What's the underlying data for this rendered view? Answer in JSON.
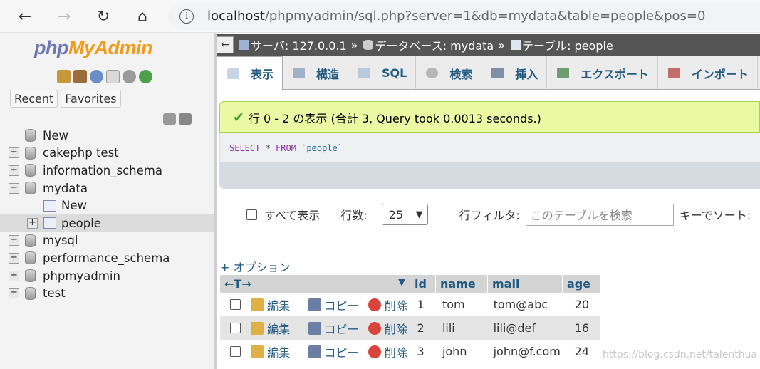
{
  "browser": {
    "url_host": "localhost",
    "url_path": "/phpmyadmin/sql.php?server=1&db=mydata&table=people&pos=0"
  },
  "sidebar": {
    "logo_php": "php",
    "logo_myadmin": "MyAdmin",
    "recent": "Recent",
    "favorites": "Favorites",
    "tree": [
      {
        "label": "New"
      },
      {
        "label": "cakephp test"
      },
      {
        "label": "information_schema"
      },
      {
        "label": "mydata"
      },
      {
        "label": "New"
      },
      {
        "label": "people"
      },
      {
        "label": "mysql"
      },
      {
        "label": "performance_schema"
      },
      {
        "label": "phpmyadmin"
      },
      {
        "label": "test"
      }
    ]
  },
  "breadcrumb": {
    "server": "サーバ: 127.0.0.1",
    "database": "データベース: mydata",
    "table": "テーブル: people",
    "sep": "»"
  },
  "menu": {
    "browse": "表示",
    "structure": "構造",
    "sql": "SQL",
    "search": "検索",
    "insert": "挿入",
    "export": "エクスポート",
    "import": "インポート"
  },
  "message": "行 0 - 2 の表示 (合計 3, Query took 0.0013 seconds.)",
  "query": {
    "select": "SELECT",
    "star": " * ",
    "from": "FROM",
    "table": " `people`"
  },
  "controls": {
    "show_all": "すべて表示",
    "rows_label": "行数:",
    "rows_value": "25",
    "filter_label": "行フィルタ:",
    "filter_placeholder": "このテーブルを検索",
    "sort_label": "キーでソート:"
  },
  "options_link": "+ オプション",
  "grid": {
    "arrows_left": "←T→",
    "columns": [
      "id",
      "name",
      "mail",
      "age"
    ],
    "edit": "編集",
    "copy": "コピー",
    "delete": "削除",
    "rows": [
      {
        "id": "1",
        "name": "tom",
        "mail": "tom@abc",
        "age": "20"
      },
      {
        "id": "2",
        "name": "lili",
        "mail": "lili@def",
        "age": "16"
      },
      {
        "id": "3",
        "name": "john",
        "mail": "john@f.com",
        "age": "24"
      }
    ]
  },
  "watermark": "https://blog.csdn.net/talenthua"
}
